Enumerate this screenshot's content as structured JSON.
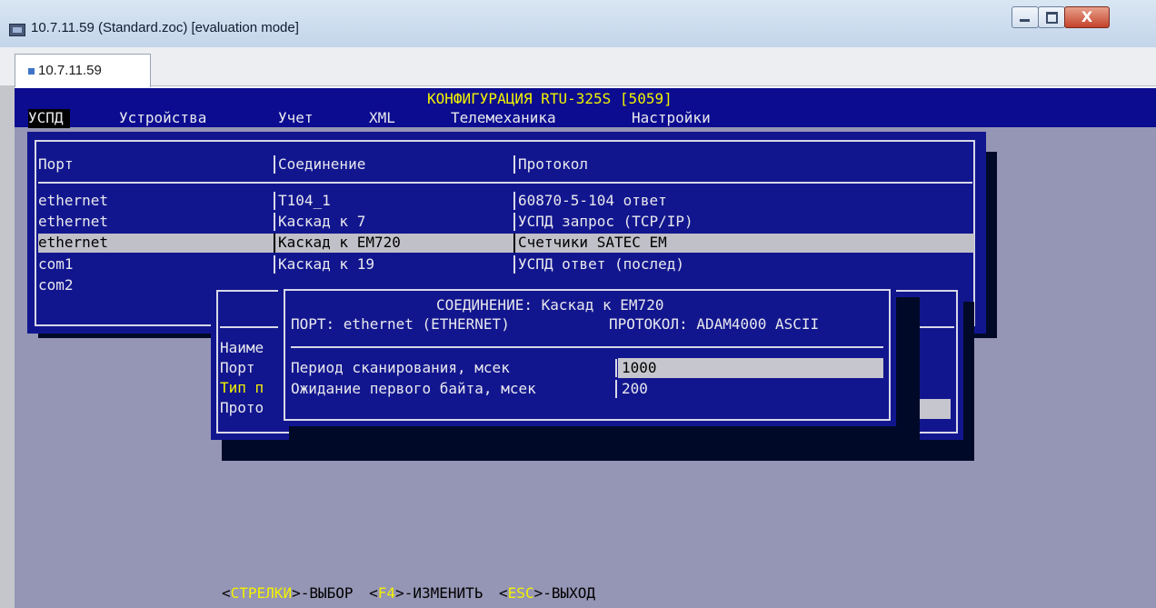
{
  "window": {
    "title": "10.7.11.59 (Standard.zoc) [evaluation mode]",
    "tab_label": "10.7.11.59",
    "close_glyph": "X",
    "icons": {
      "app": "terminal-app-icon",
      "minimize": "minimize-icon",
      "maximize": "maximize-icon",
      "close": "close-icon"
    }
  },
  "terminal": {
    "header_title": "КОНФИГУРАЦИЯ RTU-325S [5059]",
    "menu": [
      "УСПД",
      "Устройства",
      "Учет",
      "XML",
      "Телемеханика",
      "Настройки"
    ],
    "menu_active": "УСПД",
    "ports_table": {
      "columns": [
        "Порт",
        "Соединение",
        "Протокол"
      ],
      "rows": [
        {
          "port": "ethernet",
          "connection": "T104_1",
          "protocol": "60870-5-104 ответ"
        },
        {
          "port": "ethernet",
          "connection": "Каскад к 7",
          "protocol": "УСПД запрос (TCP/IP)"
        },
        {
          "port": "ethernet",
          "connection": "Каскад к EM720",
          "protocol": "Счетчики SATEC EM",
          "selected": true
        },
        {
          "port": "com1",
          "connection": "Каскад к 19",
          "protocol": "УСПД ответ (послед)"
        },
        {
          "port": "com2",
          "connection": "",
          "protocol": ""
        }
      ]
    },
    "mid_dialog": {
      "labels": [
        "Наиме",
        "Порт",
        "Тип п",
        "Прото"
      ]
    },
    "front_dialog": {
      "title": "СОЕДИНЕНИЕ: Каскад к EM720",
      "port_line": "ПОРТ: ethernet (ETHERNET)",
      "protocol_line": "ПРОТОКОЛ: ADAM4000 ASCII",
      "fields": [
        {
          "label": "Период сканирования, мсек",
          "value": "1000"
        },
        {
          "label": "Ожидание первого байта, мсек",
          "value": "200"
        }
      ]
    },
    "footer": {
      "hint1_key": "СТРЕЛКИ",
      "hint1_action": ">-ВЫБОР",
      "hint2_key": "F4",
      "hint2_action": ">-ИЗМЕНИТЬ",
      "hint3_key": "ESC",
      "hint3_action": ">-ВЫХОД",
      "open_bracket": "<"
    }
  }
}
